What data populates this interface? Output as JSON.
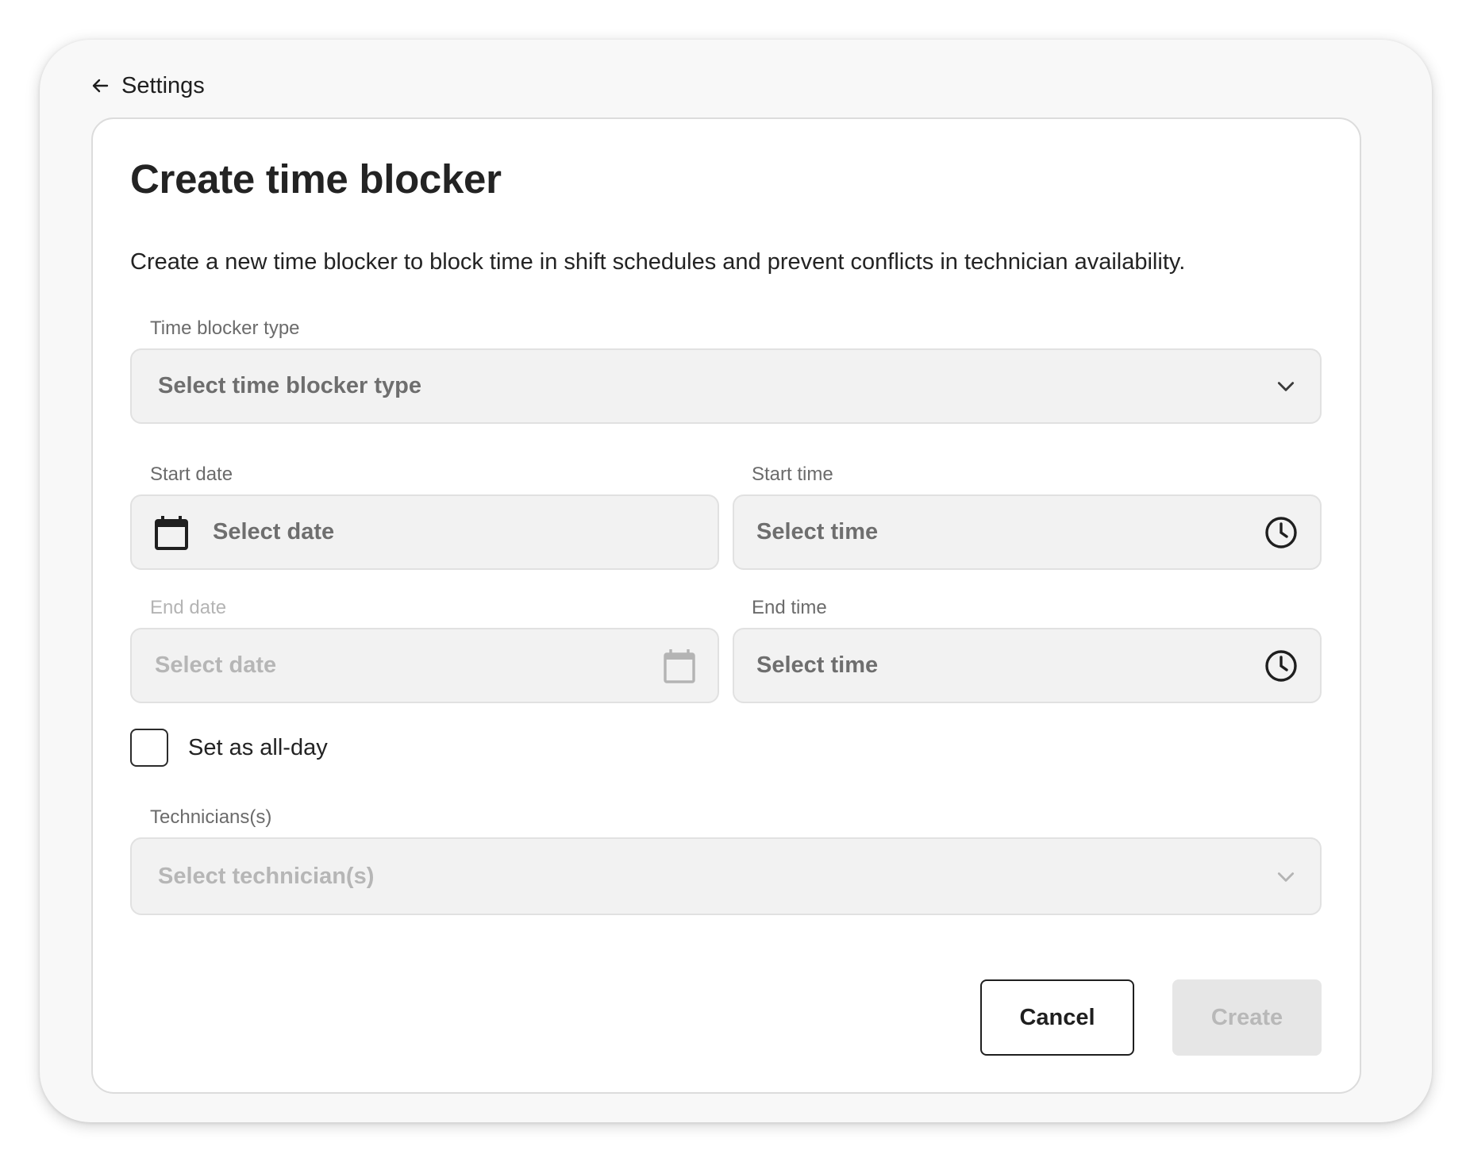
{
  "back_link": {
    "label": "Settings",
    "icon": "arrow-left-icon"
  },
  "form": {
    "title": "Create time blocker",
    "description": "Create a new time blocker to block time in shift schedules and prevent conflicts in technician availability.",
    "time_blocker_type": {
      "label": "Time blocker type",
      "placeholder": "Select time blocker type",
      "icon": "chevron-down-icon"
    },
    "start_date": {
      "label": "Start date",
      "placeholder": "Select date",
      "icon": "calendar-icon"
    },
    "start_time": {
      "label": "Start time",
      "placeholder": "Select time",
      "icon": "clock-icon"
    },
    "end_date": {
      "label": "End date",
      "placeholder": "Select date",
      "icon": "calendar-icon",
      "disabled": true
    },
    "end_time": {
      "label": "End time",
      "placeholder": "Select time",
      "icon": "clock-icon"
    },
    "all_day": {
      "label": "Set as all-day",
      "checked": false
    },
    "technicians": {
      "label": "Technicians(s)",
      "placeholder": "Select technician(s)",
      "icon": "chevron-down-icon",
      "disabled": true
    }
  },
  "actions": {
    "cancel_label": "Cancel",
    "create_label": "Create",
    "create_disabled": true
  },
  "colors": {
    "text_primary": "#232323",
    "label": "#6b6b6b",
    "field_bg": "#f2f2f2",
    "disabled_text": "#b6b6b6",
    "window_bg": "#f8f8f8"
  }
}
